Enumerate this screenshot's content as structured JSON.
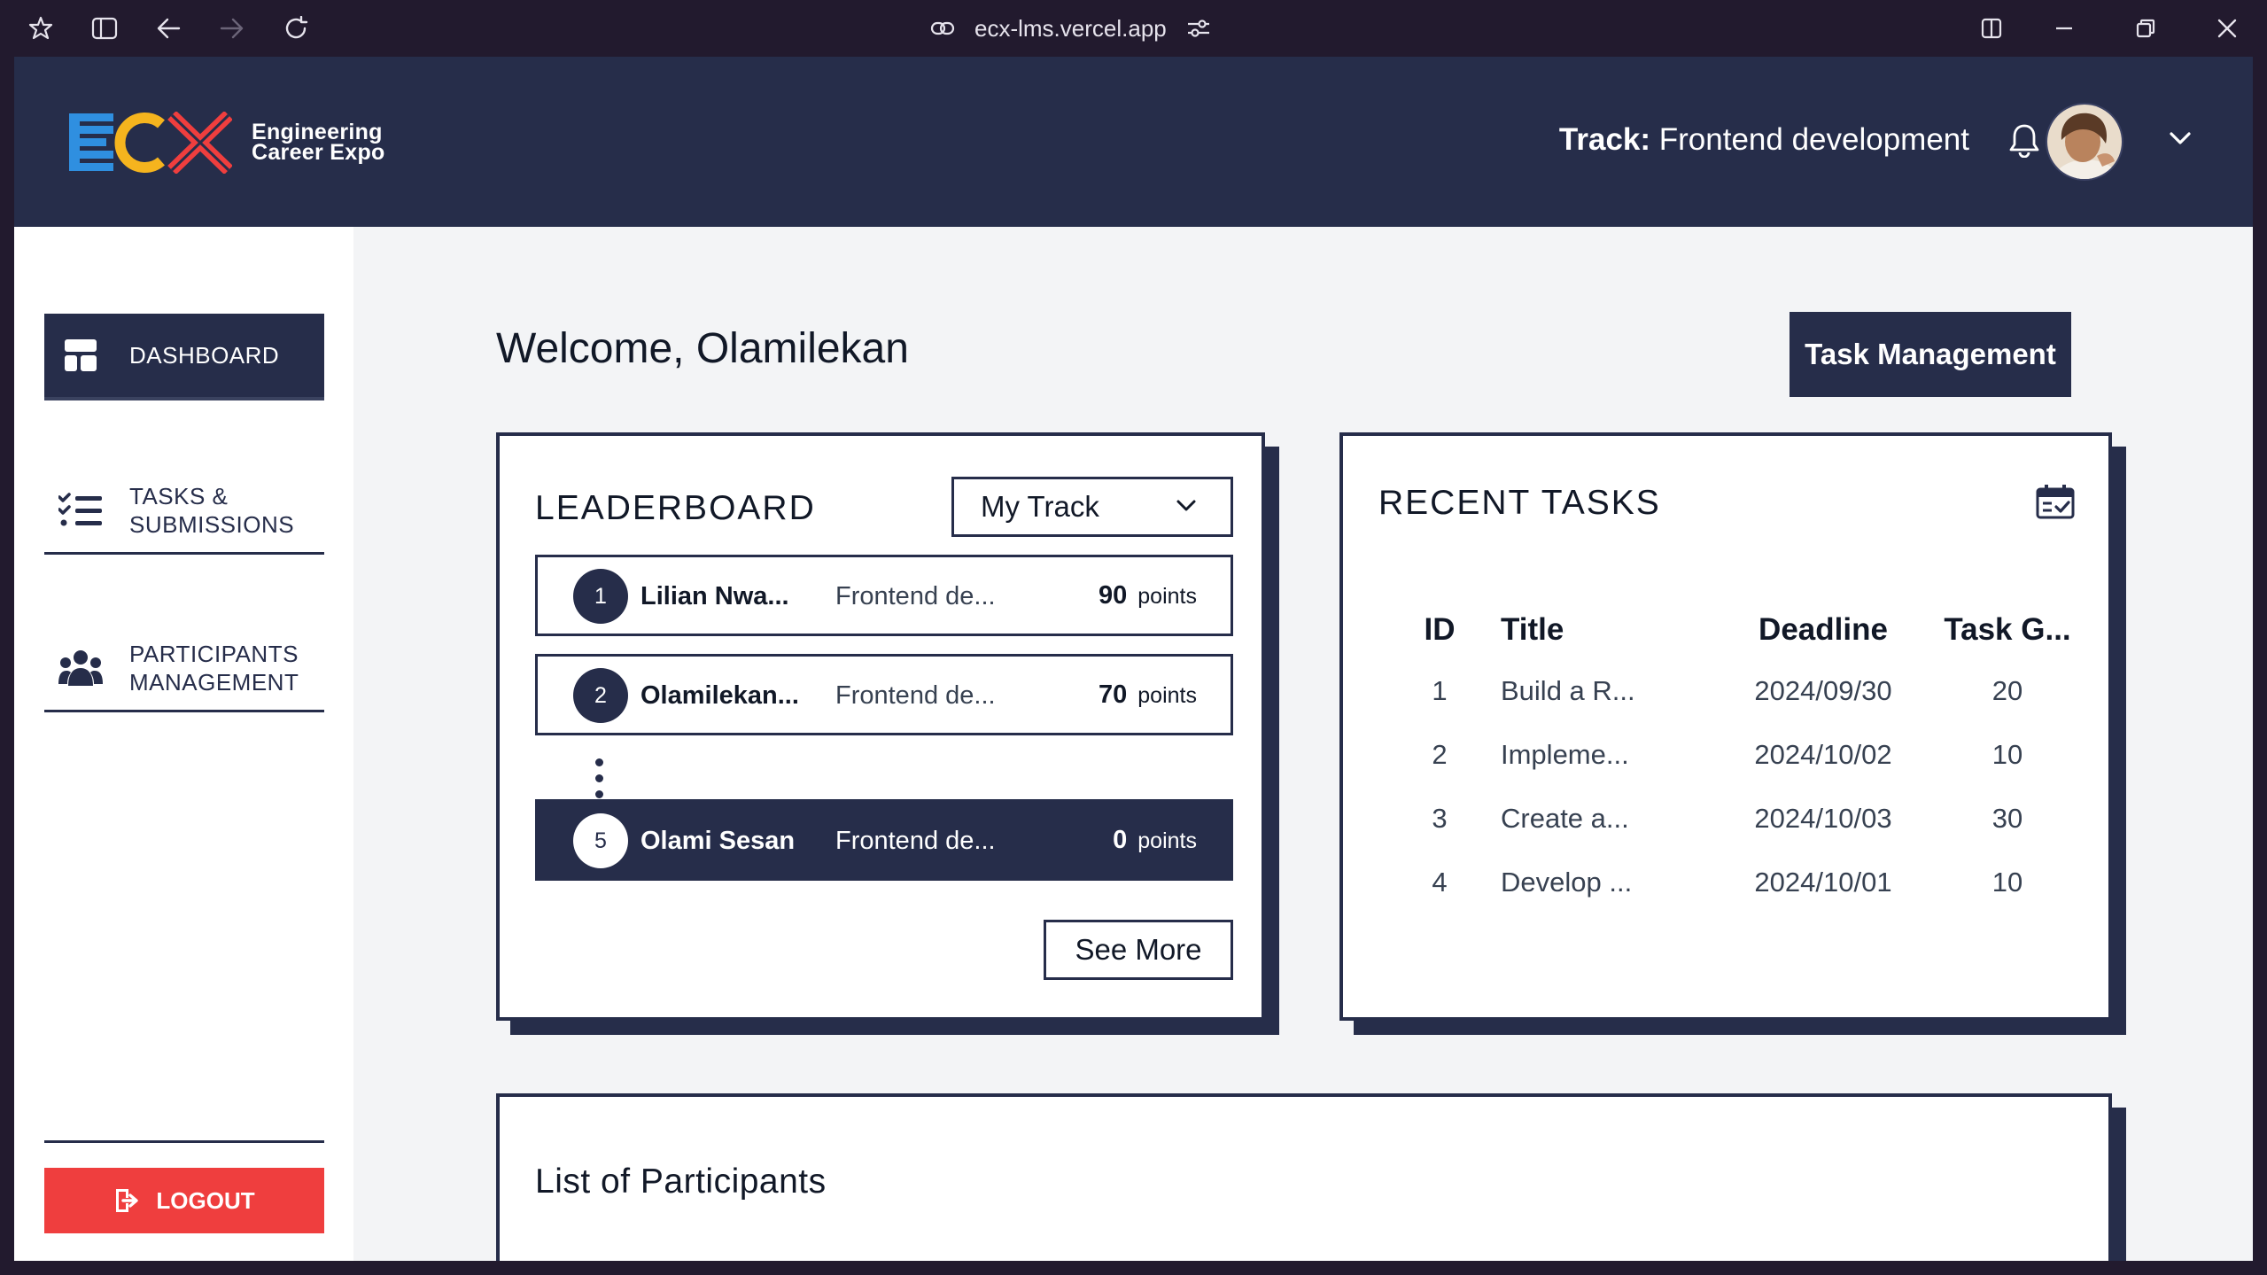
{
  "browser": {
    "url": "ecx-lms.vercel.app"
  },
  "header": {
    "logo_mark": "ECX",
    "logo_line1": "Engineering",
    "logo_line2": "Career Expo",
    "track_label": "Track:",
    "track_value": "Frontend development"
  },
  "sidebar": {
    "items": [
      {
        "label": "DASHBOARD",
        "icon": "dashboard-icon",
        "active": true
      },
      {
        "label_line1": "TASKS &",
        "label_line2": "SUBMISSIONS",
        "icon": "checklist-icon"
      },
      {
        "label_line1": "PARTICIPANTS",
        "label_line2": "MANAGEMENT",
        "icon": "users-icon"
      }
    ],
    "logout_label": "LOGOUT"
  },
  "main": {
    "welcome": "Welcome, Olamilekan",
    "task_management_label": "Task Management"
  },
  "leaderboard": {
    "title": "LEADERBOARD",
    "filter_selected": "My Track",
    "points_unit": "points",
    "rows": [
      {
        "rank": "1",
        "name": "Lilian Nwa...",
        "track": "Frontend de...",
        "points": "90"
      },
      {
        "rank": "2",
        "name": "Olamilekan...",
        "track": "Frontend de...",
        "points": "70"
      },
      {
        "rank": "5",
        "name": "Olami Sesan",
        "track": "Frontend de...",
        "points": "0"
      }
    ],
    "see_more_label": "See More"
  },
  "recent_tasks": {
    "title": "RECENT TASKS",
    "columns": [
      "ID",
      "Title",
      "Deadline",
      "Task G..."
    ],
    "rows": [
      {
        "id": "1",
        "title": "Build a R...",
        "deadline": "2024/09/30",
        "grade": "20"
      },
      {
        "id": "2",
        "title": "Impleme...",
        "deadline": "2024/10/02",
        "grade": "10"
      },
      {
        "id": "3",
        "title": "Create a...",
        "deadline": "2024/10/03",
        "grade": "30"
      },
      {
        "id": "4",
        "title": "Develop ...",
        "deadline": "2024/10/01",
        "grade": "10"
      }
    ]
  },
  "participants": {
    "title": "List of Participants"
  },
  "colors": {
    "navy": "#262d4a",
    "logout_red": "#ef3e3e",
    "logo_blue": "#2f8fe0",
    "logo_yellow": "#f5b41e",
    "logo_red": "#ef3e3e",
    "page_bg": "#f3f4f6"
  }
}
